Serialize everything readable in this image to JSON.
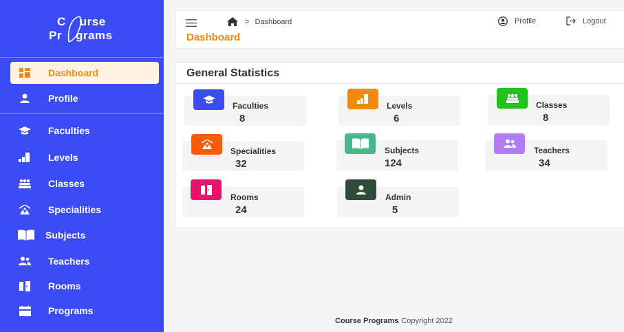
{
  "brand": {
    "line1_a": "C",
    "line1_b": "urse",
    "line2_a": "Pr",
    "line2_b": "grams"
  },
  "sidebar": {
    "items": [
      {
        "label": "Dashboard",
        "icon": "dashboard-icon",
        "active": true
      },
      {
        "label": "Profile",
        "icon": "user-icon"
      },
      {
        "label": "Faculties",
        "icon": "graduation-cap-icon"
      },
      {
        "label": "Levels",
        "icon": "bar-chart-icon"
      },
      {
        "label": "Classes",
        "icon": "users-group-icon"
      },
      {
        "label": "Specialities",
        "icon": "campground-icon"
      },
      {
        "label": "Subjects",
        "icon": "book-open-icon"
      },
      {
        "label": "Teachers",
        "icon": "user-friends-icon"
      },
      {
        "label": "Rooms",
        "icon": "door-icon"
      },
      {
        "label": "Programs",
        "icon": "calendar-icon"
      }
    ]
  },
  "header": {
    "breadcrumb_sep": ">",
    "breadcrumb_current": "Dashboard",
    "title": "Dashboard",
    "profile_label": "Profile",
    "logout_label": "Logout"
  },
  "stats": {
    "title": "General Statistics",
    "items": [
      {
        "label": "Faculties",
        "value": "8",
        "color": "#3b4cf5",
        "icon": "graduation-cap-icon"
      },
      {
        "label": "Levels",
        "value": "6",
        "color": "#f48a07",
        "icon": "bar-chart-icon"
      },
      {
        "label": "Classes",
        "value": "8",
        "color": "#21c21b",
        "icon": "users-group-icon"
      },
      {
        "label": "Specialities",
        "value": "32",
        "color": "#ff5a0a",
        "icon": "campground-icon"
      },
      {
        "label": "Subjects",
        "value": "124",
        "color": "#47b889",
        "icon": "book-open-icon"
      },
      {
        "label": "Teachers",
        "value": "34",
        "color": "#b27cf5",
        "icon": "user-friends-icon"
      },
      {
        "label": "Rooms",
        "value": "24",
        "color": "#e8136f",
        "icon": "door-icon"
      },
      {
        "label": "Admin",
        "value": "5",
        "color": "#2f4a37",
        "icon": "user-icon"
      }
    ]
  },
  "footer": {
    "brand": "Course Programs",
    "text": "Copyright 2022"
  }
}
